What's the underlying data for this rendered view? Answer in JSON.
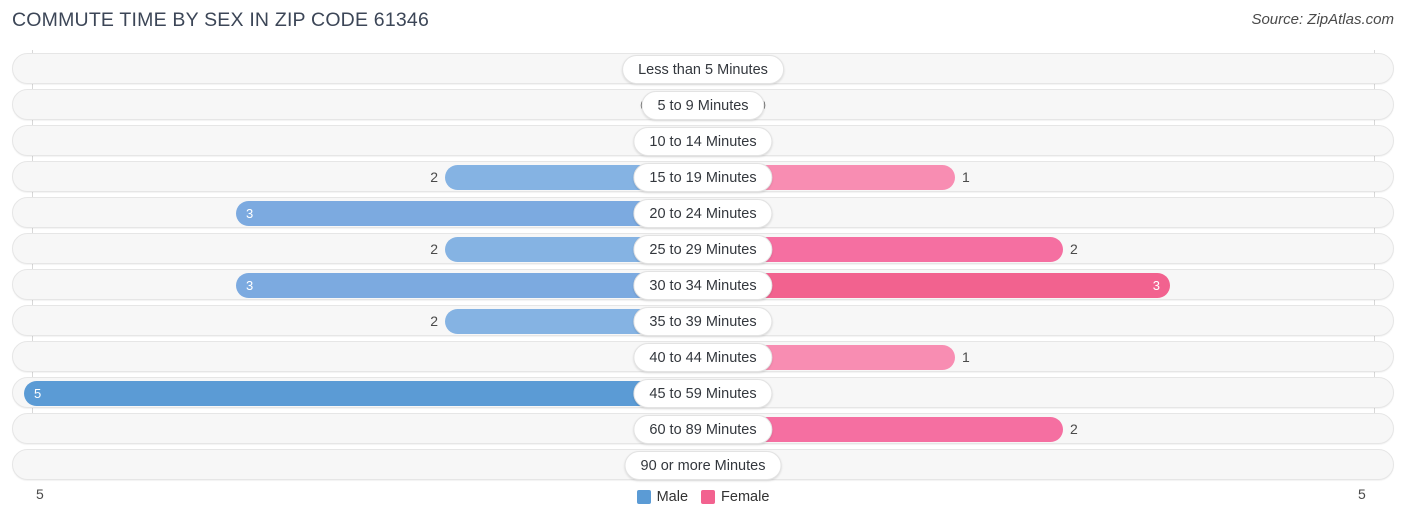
{
  "header": {
    "title": "COMMUTE TIME BY SEX IN ZIP CODE 61346",
    "source": "Source: ZipAtlas.com"
  },
  "legend": {
    "male_label": "Male",
    "female_label": "Female",
    "male_color": "#5b9bd5",
    "female_color": "#f2628f"
  },
  "axis": {
    "left_tick": "5",
    "right_tick": "5"
  },
  "chart_data": {
    "type": "bar",
    "title": "COMMUTE TIME BY SEX IN ZIP CODE 61346",
    "subtitle": "Source: ZipAtlas.com",
    "orientation": "horizontal-diverging",
    "xlabel": "",
    "ylabel": "",
    "xlim": [
      5,
      5
    ],
    "grid": false,
    "legend_position": "bottom-center",
    "categories": [
      "Less than 5 Minutes",
      "5 to 9 Minutes",
      "10 to 14 Minutes",
      "15 to 19 Minutes",
      "20 to 24 Minutes",
      "25 to 29 Minutes",
      "30 to 34 Minutes",
      "35 to 39 Minutes",
      "40 to 44 Minutes",
      "45 to 59 Minutes",
      "60 to 89 Minutes",
      "90 or more Minutes"
    ],
    "series": [
      {
        "name": "Male",
        "values": [
          0,
          0,
          0,
          2,
          3,
          2,
          3,
          2,
          0,
          5,
          0,
          0
        ]
      },
      {
        "name": "Female",
        "values": [
          0,
          0,
          0,
          1,
          0,
          2,
          3,
          0,
          1,
          0,
          2,
          0
        ]
      }
    ]
  },
  "rows": [
    {
      "label": "Less than 5 Minutes",
      "male": "0",
      "female": "0",
      "male_w": 48,
      "female_w": 48,
      "male_color": "#aecbec",
      "female_color": "#f8a8c4",
      "male_inside": false,
      "female_inside": false
    },
    {
      "label": "5 to 9 Minutes",
      "male": "0",
      "female": "0",
      "male_w": 48,
      "female_w": 48,
      "male_color": "#aecbec",
      "female_color": "#f8a8c4",
      "male_inside": false,
      "female_inside": false
    },
    {
      "label": "10 to 14 Minutes",
      "male": "0",
      "female": "0",
      "male_w": 48,
      "female_w": 48,
      "male_color": "#aecbec",
      "female_color": "#f8a8c4",
      "male_inside": false,
      "female_inside": false
    },
    {
      "label": "15 to 19 Minutes",
      "male": "2",
      "female": "1",
      "male_w": 258,
      "female_w": 252,
      "male_color": "#85b3e3",
      "female_color": "#f88db2",
      "male_inside": false,
      "female_inside": false
    },
    {
      "label": "20 to 24 Minutes",
      "male": "3",
      "female": "0",
      "male_w": 467,
      "female_w": 48,
      "male_color": "#7caae0",
      "female_color": "#f8a8c4",
      "male_inside": true,
      "female_inside": false
    },
    {
      "label": "25 to 29 Minutes",
      "male": "2",
      "female": "2",
      "male_w": 258,
      "female_w": 360,
      "male_color": "#85b3e3",
      "female_color": "#f56fa1",
      "male_inside": false,
      "female_inside": false
    },
    {
      "label": "30 to 34 Minutes",
      "male": "3",
      "female": "3",
      "male_w": 467,
      "female_w": 467,
      "male_color": "#7caae0",
      "female_color": "#f2628f",
      "male_inside": true,
      "female_inside": true
    },
    {
      "label": "35 to 39 Minutes",
      "male": "2",
      "female": "0",
      "male_w": 258,
      "female_w": 48,
      "male_color": "#85b3e3",
      "female_color": "#f8a8c4",
      "male_inside": false,
      "female_inside": false
    },
    {
      "label": "40 to 44 Minutes",
      "male": "0",
      "female": "1",
      "male_w": 48,
      "female_w": 252,
      "male_color": "#aecbec",
      "female_color": "#f88db2",
      "male_inside": false,
      "female_inside": false
    },
    {
      "label": "45 to 59 Minutes",
      "male": "5",
      "female": "0",
      "male_w": 679,
      "female_w": 48,
      "male_color": "#5b9bd5",
      "female_color": "#f8a8c4",
      "male_inside": true,
      "female_inside": false
    },
    {
      "label": "60 to 89 Minutes",
      "male": "0",
      "female": "2",
      "male_w": 48,
      "female_w": 360,
      "male_color": "#aecbec",
      "female_color": "#f56fa1",
      "male_inside": false,
      "female_inside": false
    },
    {
      "label": "90 or more Minutes",
      "male": "0",
      "female": "0",
      "male_w": 48,
      "female_w": 48,
      "male_color": "#aecbec",
      "female_color": "#f8a8c4",
      "male_inside": false,
      "female_inside": false
    }
  ]
}
